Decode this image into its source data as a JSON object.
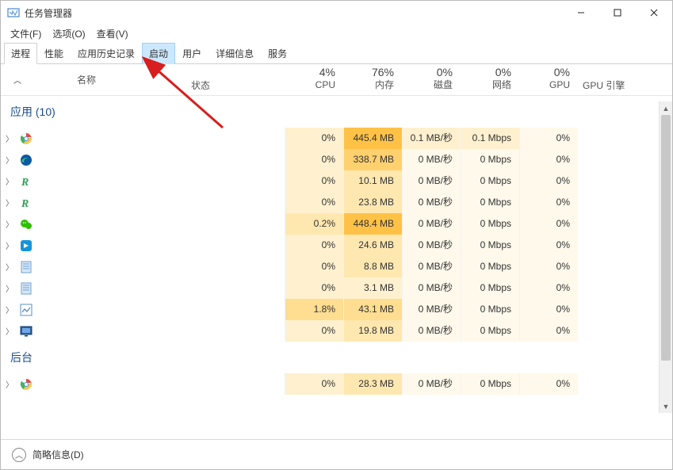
{
  "window": {
    "title": "任务管理器",
    "min_tip": "最小化",
    "max_tip": "最大化",
    "close_tip": "关闭"
  },
  "menubar": {
    "file": "文件(F)",
    "options": "选项(O)",
    "view": "查看(V)"
  },
  "tabs": {
    "processes": "进程",
    "performance": "性能",
    "apphistory": "应用历史记录",
    "startup": "启动",
    "users": "用户",
    "details": "详细信息",
    "services": "服务"
  },
  "headers": {
    "name": "名称",
    "status": "状态",
    "cpu_pct": "4%",
    "cpu": "CPU",
    "mem_pct": "76%",
    "mem": "内存",
    "disk_pct": "0%",
    "disk": "磁盘",
    "net_pct": "0%",
    "net": "网络",
    "gpu_pct": "0%",
    "gpu": "GPU",
    "gpu_engine": "GPU 引擎"
  },
  "groups": {
    "apps": "应用 (10)",
    "background": "后台"
  },
  "rows": [
    {
      "icon": "chrome",
      "cpu": "0%",
      "cpu_h": "h1",
      "mem": "445.4 MB",
      "mem_h": "h5",
      "disk": "0.1 MB/秒",
      "disk_h": "h1",
      "net": "0.1 Mbps",
      "net_h": "h1",
      "gpu": "0%",
      "gpu_h": "h0"
    },
    {
      "icon": "edge",
      "cpu": "0%",
      "cpu_h": "h1",
      "mem": "338.7 MB",
      "mem_h": "h4",
      "disk": "0 MB/秒",
      "disk_h": "h0",
      "net": "0 Mbps",
      "net_h": "h0",
      "gpu": "0%",
      "gpu_h": "h0"
    },
    {
      "icon": "r-green",
      "cpu": "0%",
      "cpu_h": "h1",
      "mem": "10.1 MB",
      "mem_h": "h2",
      "disk": "0 MB/秒",
      "disk_h": "h0",
      "net": "0 Mbps",
      "net_h": "h0",
      "gpu": "0%",
      "gpu_h": "h0"
    },
    {
      "icon": "r-green",
      "cpu": "0%",
      "cpu_h": "h1",
      "mem": "23.8 MB",
      "mem_h": "h2",
      "disk": "0 MB/秒",
      "disk_h": "h0",
      "net": "0 Mbps",
      "net_h": "h0",
      "gpu": "0%",
      "gpu_h": "h0"
    },
    {
      "icon": "wechat",
      "cpu": "0.2%",
      "cpu_h": "h2",
      "mem": "448.4 MB",
      "mem_h": "h5",
      "disk": "0 MB/秒",
      "disk_h": "h0",
      "net": "0 Mbps",
      "net_h": "h0",
      "gpu": "0%",
      "gpu_h": "h0"
    },
    {
      "icon": "blue-sq",
      "cpu": "0%",
      "cpu_h": "h1",
      "mem": "24.6 MB",
      "mem_h": "h2",
      "disk": "0 MB/秒",
      "disk_h": "h0",
      "net": "0 Mbps",
      "net_h": "h0",
      "gpu": "0%",
      "gpu_h": "h0"
    },
    {
      "icon": "notepad",
      "cpu": "0%",
      "cpu_h": "h1",
      "mem": "8.8 MB",
      "mem_h": "h2",
      "disk": "0 MB/秒",
      "disk_h": "h0",
      "net": "0 Mbps",
      "net_h": "h0",
      "gpu": "0%",
      "gpu_h": "h0"
    },
    {
      "icon": "notepad",
      "cpu": "0%",
      "cpu_h": "h1",
      "mem": "3.1 MB",
      "mem_h": "h1",
      "disk": "0 MB/秒",
      "disk_h": "h0",
      "net": "0 Mbps",
      "net_h": "h0",
      "gpu": "0%",
      "gpu_h": "h0"
    },
    {
      "icon": "snip",
      "cpu": "1.8%",
      "cpu_h": "h3",
      "mem": "43.1 MB",
      "mem_h": "h3",
      "disk": "0 MB/秒",
      "disk_h": "h0",
      "net": "0 Mbps",
      "net_h": "h0",
      "gpu": "0%",
      "gpu_h": "h0"
    },
    {
      "icon": "display",
      "cpu": "0%",
      "cpu_h": "h1",
      "mem": "19.8 MB",
      "mem_h": "h2",
      "disk": "0 MB/秒",
      "disk_h": "h0",
      "net": "0 Mbps",
      "net_h": "h0",
      "gpu": "0%",
      "gpu_h": "h0"
    }
  ],
  "bg_rows": [
    {
      "icon": "chrome",
      "cpu": "0%",
      "cpu_h": "h1",
      "mem": "28.3 MB",
      "mem_h": "h2",
      "disk": "0 MB/秒",
      "disk_h": "h0",
      "net": "0 Mbps",
      "net_h": "h0",
      "gpu": "0%",
      "gpu_h": "h0"
    }
  ],
  "footer": {
    "fewer_details": "简略信息(D)"
  }
}
